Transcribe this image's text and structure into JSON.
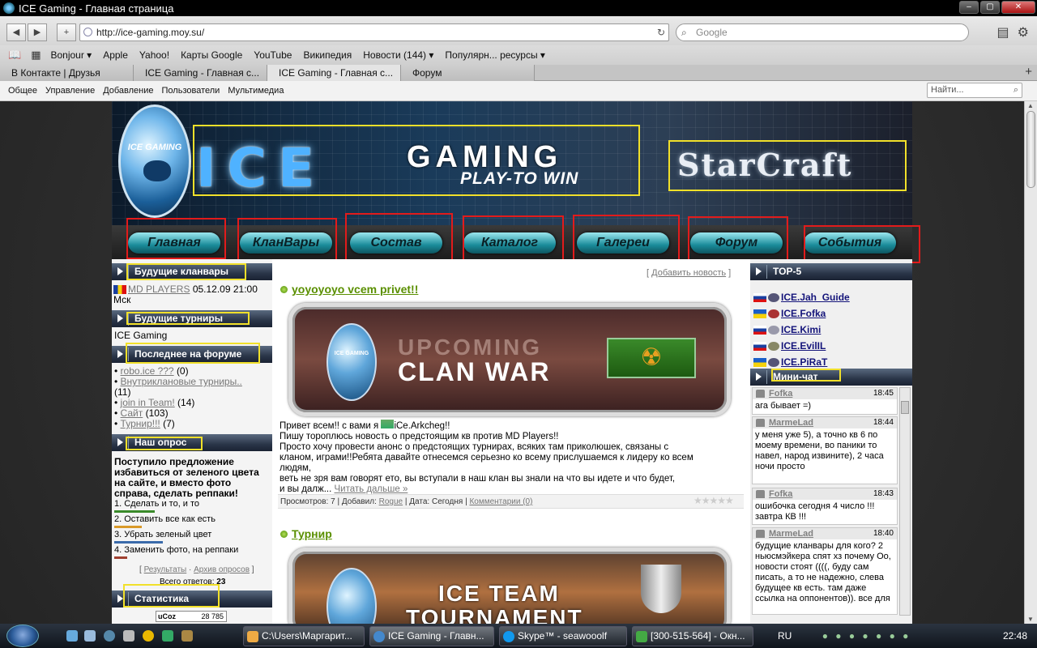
{
  "window": {
    "title": "ICE Gaming - Главная страница"
  },
  "toolbar": {
    "url": "http://ice-gaming.moy.su/",
    "search_placeholder": "Google"
  },
  "bookmarks": [
    "Bonjour ▾",
    "Apple",
    "Yahoo!",
    "Карты Google",
    "YouTube",
    "Википедия",
    "Новости (144) ▾",
    "Популярн... ресурсы ▾"
  ],
  "tabs": [
    "В Контакте | Друзья",
    "ICE Gaming - Главная с...",
    "ICE Gaming - Главная с...",
    "Форум"
  ],
  "adminbar": {
    "items": [
      "Общее",
      "Управление",
      "Добавление",
      "Пользователи",
      "Мультимедиа"
    ],
    "find_placeholder": "Найти..."
  },
  "banner": {
    "emblem_text": "ICE GAMING",
    "logo_ice": "ICE",
    "logo_gaming": "GAMING",
    "logo_tagline": "PLAY-TO WIN",
    "logo_starcraft": "StarCraft"
  },
  "nav": [
    "Главная",
    "КланВары",
    "Состав",
    "Каталог",
    "Галереи",
    "Форум",
    "События"
  ],
  "left": {
    "h1": "Будущие кланвары",
    "clanwar_team": "MD PLAYERS",
    "clanwar_time": "05.12.09 21:00",
    "clanwar_tz": "Мск",
    "h2": "Будущие турниры",
    "tournament": "ICE Gaming",
    "h3": "Последнее на форуме",
    "forum": [
      {
        "t": "robo.ice ???",
        "c": "(0)"
      },
      {
        "t": "Внутриклановые турниры..",
        "c": "(11)"
      },
      {
        "t": "join in Team!",
        "c": "(14)"
      },
      {
        "t": "Сайт",
        "c": "(103)"
      },
      {
        "t": "Турнир!!!",
        "c": "(7)"
      }
    ],
    "h4": "Наш опрос",
    "poll_q": "Поступило предложение избавиться от зеленого цвета на сайте, и вместо фото справа, сделать реппаки!",
    "poll_opts": [
      "1. Сделать и то, и то",
      "2. Оставить все как есть",
      "3. Убрать зеленый цвет",
      "4. Заменить фото, на реппаки"
    ],
    "poll_results": "Результаты",
    "poll_archive": "Архив опросов",
    "poll_total_label": "Всего ответов:",
    "poll_total": "23",
    "h5": "Статистика",
    "counter": "28 785",
    "counter_label": "uCoz"
  },
  "center": {
    "add_news": "Добавить новость",
    "news1_title": "yoyoyoyo vcem privet!!",
    "img1_top": "UPCOMING",
    "img1_text": "CLAN WAR",
    "img1_badge": "ICE GAMING",
    "greeting": "Привет всем!! с вами я",
    "greeting_nick": "iCe.Arkcheg!!",
    "body": [
      "Пишу тороплюсь новость о предстоящим кв против MD Players!!",
      "Просто хочу провести анонс о предстоящих турнирах, всяких там приколюшек, связаны с",
      "кланом, играми!!Ребята давайте отнесемся серьезно ко всему прислушаемся к лидеру ко всем",
      "людям,",
      "веть не зря вам говорят ето, вы вступали в наш клан вы знали на что вы идете и что будет,"
    ],
    "body_last": "и вы далж...",
    "read_more": "Читать дальше »",
    "meta_views_label": "Просмотров:",
    "meta_views": "7",
    "meta_added_label": "Добавил:",
    "meta_added": "Rogue",
    "meta_date_label": "Дата:",
    "meta_date": "Сегодня",
    "meta_comments": "Комментарии (0)",
    "news2_title": "Турнир",
    "img2_text1": "ICE TEAM",
    "img2_text2": "TOURNAMENT"
  },
  "right": {
    "h1": "TOP-5",
    "top": [
      "ICE.Jah_Guide",
      "ICE.Fofka",
      "ICE.Kimi",
      "ICE.EvilIL",
      "ICE.PiRaT"
    ],
    "h2": "Мини-чат",
    "chat": [
      {
        "name": "Fofka",
        "time": "18:45",
        "text": "ага бывает =)"
      },
      {
        "name": "MarmeLad",
        "time": "18:44",
        "text": "у меня уже 5), а точно кв 6 по моему времени, во паники то навел, народ извините), 2 часа ночи просто"
      },
      {
        "name": "Fofka",
        "time": "18:43",
        "text": "ошибочка сегодня 4 число !!! завтра КВ !!!"
      },
      {
        "name": "MarmeLad",
        "time": "18:40",
        "text": "будущие кланвары для кого? 2 ньюсмэйкера спят хз почему Оо, новости стоят ((((, буду сам писать, а то не надежно, слева будущее кв есть. там даже ссылка на оппонентов)). все для"
      }
    ]
  },
  "taskbar": {
    "tasks": [
      "C:\\Users\\Маргарит...",
      "ICE Gaming - Главн...",
      "Skype™ - seawooolf",
      "[300-515-564] - Окн..."
    ],
    "lang": "RU",
    "clock": "22:48"
  },
  "colors": {
    "nav_teal": "#1a8c9a",
    "title_green": "#5a8f00",
    "highlight_yellow": "#f1e02a",
    "highlight_red": "#e21b1b"
  }
}
